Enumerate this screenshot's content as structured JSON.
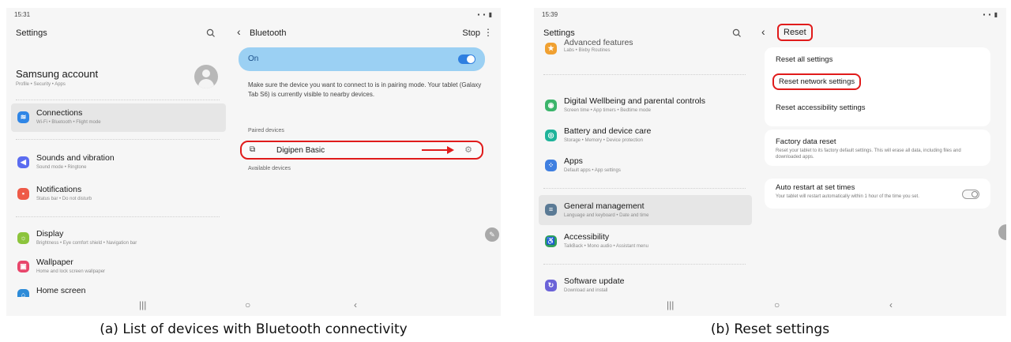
{
  "captions": {
    "a": "(a) List of devices with Bluetooth connectivity",
    "b": "(b) Reset settings"
  },
  "panel_a": {
    "status": {
      "time": "15:31",
      "icons": "▪ ▪ ▮"
    },
    "settings_title": "Settings",
    "account": {
      "name": "Samsung account",
      "sub": "Profile • Security • Apps"
    },
    "menu": [
      {
        "title": "Connections",
        "sub": "Wi-Fi • Bluetooth • Flight mode",
        "icon_color": "#2f86e6",
        "icon": "wifi-icon"
      },
      {
        "title": "Sounds and vibration",
        "sub": "Sound mode • Ringtone",
        "icon_color": "#5b6cf0",
        "icon": "speaker-icon"
      },
      {
        "title": "Notifications",
        "sub": "Status bar • Do not disturb",
        "icon_color": "#ee5a48",
        "icon": "bell-icon"
      },
      {
        "title": "Display",
        "sub": "Brightness • Eye comfort shield • Navigation bar",
        "icon_color": "#8cc43c",
        "icon": "sun-icon"
      },
      {
        "title": "Wallpaper",
        "sub": "Home and lock screen wallpaper",
        "icon_color": "#e8466b",
        "icon": "image-icon"
      },
      {
        "title": "Home screen",
        "sub": "",
        "icon_color": "#2d8bd8",
        "icon": "home-icon"
      }
    ],
    "bluetooth": {
      "title": "Bluetooth",
      "stop": "Stop",
      "more": "⋮",
      "on_label": "On",
      "info": "Make sure the device you want to connect to is in pairing mode. Your tablet (Galaxy Tab S6) is currently visible to nearby devices.",
      "paired_label": "Paired devices",
      "device_name": "Digipen Basic",
      "available_label": "Available devices"
    },
    "nav": {
      "recents": "|||",
      "home": "○",
      "back": "‹"
    }
  },
  "panel_b": {
    "status": {
      "time": "15:39",
      "icons": "▪ ▪ ▮"
    },
    "settings_title": "Settings",
    "partial_top": {
      "title": "Advanced features",
      "sub": "Labs • Bixby Routines"
    },
    "menu": [
      {
        "title": "Digital Wellbeing and parental controls",
        "sub": "Screen time • App timers • Bedtime mode",
        "icon_color": "#3bb56b",
        "icon": "wellbeing-icon"
      },
      {
        "title": "Battery and device care",
        "sub": "Storage • Memory • Device protection",
        "icon_color": "#1fb39a",
        "icon": "battery-icon"
      },
      {
        "title": "Apps",
        "sub": "Default apps • App settings",
        "icon_color": "#3f7fe0",
        "icon": "apps-icon"
      },
      {
        "title": "General management",
        "sub": "Language and keyboard • Date and time",
        "icon_color": "#5a7a95",
        "icon": "sliders-icon"
      },
      {
        "title": "Accessibility",
        "sub": "TalkBack • Mono audio • Assistant menu",
        "icon_color": "#2fa05a",
        "icon": "accessibility-icon"
      },
      {
        "title": "Software update",
        "sub": "Download and install",
        "icon_color": "#6b63d8",
        "icon": "update-icon"
      }
    ],
    "reset": {
      "title": "Reset",
      "items": [
        "Reset all settings",
        "Reset network settings",
        "Reset accessibility settings"
      ],
      "factory_title": "Factory data reset",
      "factory_sub": "Reset your tablet to its factory default settings. This will erase all data, including files and downloaded apps.",
      "auto_title": "Auto restart at set times",
      "auto_sub": "Your tablet will restart automatically within 1 hour of the time you set."
    },
    "nav": {
      "recents": "|||",
      "home": "○",
      "back": "‹"
    }
  }
}
